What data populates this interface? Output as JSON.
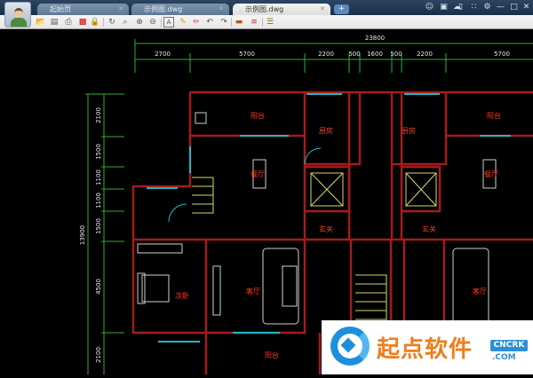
{
  "tabs": [
    {
      "label": "起始页"
    },
    {
      "label": "示例图.dwg"
    },
    {
      "label": "示例图.dwg",
      "active": true
    }
  ],
  "new_tab": "+",
  "window_icons": [
    "share-user-icon",
    "export-image-icon",
    "cloud-icon",
    "mobile-icon",
    "fullscreen-icon",
    "settings-icon",
    "minimize-icon",
    "maximize-icon",
    "close-icon"
  ],
  "toolbar": [
    "open-icon",
    "save-icon",
    "print-icon",
    "pdf-icon",
    "lock-icon",
    "zoom-rotate-icon",
    "zoom-window-icon",
    "zoom-in-icon",
    "zoom-out-icon",
    "text-icon",
    "pencil-icon",
    "markup-icon",
    "undo-icon",
    "redo-icon",
    "measure-icon",
    "hatch-icon",
    "layers-icon"
  ],
  "dimensions": {
    "total_width": "23800",
    "top": [
      "2700",
      "5700",
      "2200",
      "500",
      "1600",
      "500",
      "2200",
      "5700"
    ],
    "total_height": "13900",
    "left": [
      "2100",
      "1500",
      "1100",
      "1100",
      "1500",
      "4500",
      "2100"
    ]
  },
  "rooms": {
    "balcony_left": "阳台",
    "kitchen_left": "厨房",
    "dining_left": "餐厅",
    "foyer_left": "玄关",
    "bedroom": "次卧",
    "living_left": "客厅",
    "balcony_bottom": "阳台",
    "balcony_right": "阳台",
    "kitchen_right": "厨房",
    "dining_right": "餐厅",
    "foyer_right": "玄关",
    "living_right": "客厅"
  },
  "watermark": {
    "name": "起点软件",
    "badge": "CNCRK",
    "domain": ".COM"
  },
  "colors": {
    "wall": "#a31c1c",
    "dim": "#2fae2f",
    "window": "#1fb7c7",
    "label": "#ff3b1f",
    "titlebar": "#22385a"
  }
}
